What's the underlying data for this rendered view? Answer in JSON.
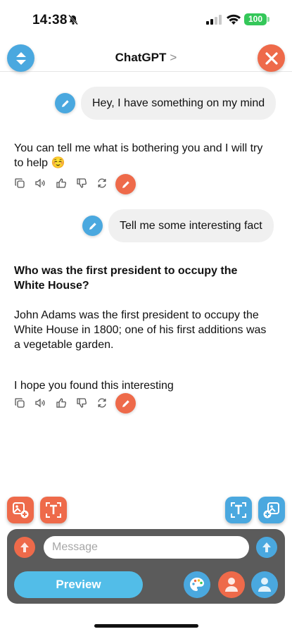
{
  "status_bar": {
    "time": "14:38",
    "battery": "100",
    "icons": [
      "bell-slash-icon",
      "signal-icon",
      "wifi-icon"
    ]
  },
  "nav": {
    "title": "ChatGPT",
    "chevron": ">",
    "left_icon": "sort-arrows-icon",
    "right_icon": "close-icon"
  },
  "messages": [
    {
      "role": "user",
      "text": "Hey, I have something on my mind"
    },
    {
      "role": "assistant",
      "lines": [
        "You can tell me what is bothering you and I will try",
        "to help ☺️"
      ]
    },
    {
      "role": "user",
      "text": "Tell me some interesting fact"
    },
    {
      "role": "assistant",
      "heading": [
        "Who was the first president to occupy the",
        "White House?"
      ],
      "body": [
        "John Adams was the first president to occupy the",
        "White House in 1800; one of his first additions was",
        "a vegetable garden."
      ],
      "closing": "I hope you found this interesting"
    }
  ],
  "message_actions": [
    "copy-icon",
    "speaker-icon",
    "thumbs-up-icon",
    "thumbs-down-icon",
    "regenerate-icon",
    "edit-icon"
  ],
  "composer": {
    "placeholder": "Message",
    "preview_label": "Preview"
  },
  "colors": {
    "blue": "#4aa8df",
    "orange": "#ee6a4a",
    "panel": "#5b5b5b",
    "bubble": "#f0f0f0",
    "preview": "#52bde8"
  }
}
